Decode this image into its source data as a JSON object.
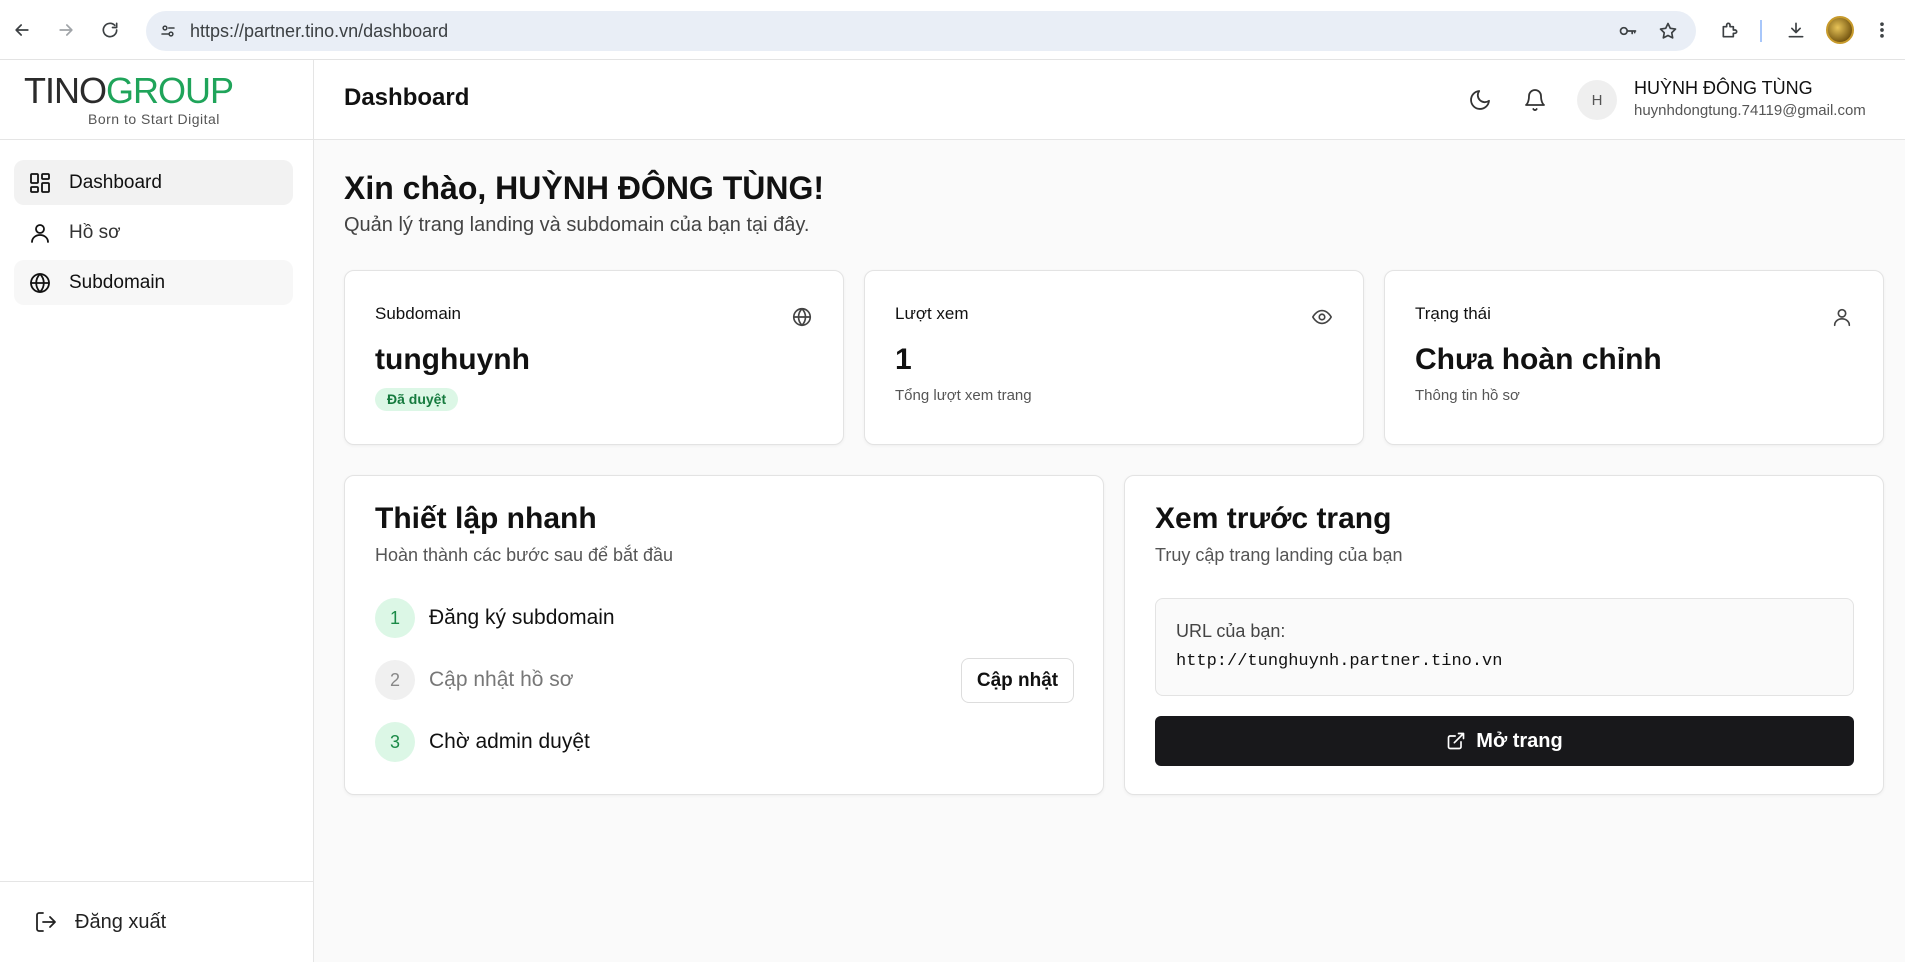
{
  "browser": {
    "url": "https://partner.tino.vn/dashboard",
    "icons": [
      "back-icon",
      "forward-icon",
      "reload-icon",
      "site-info-icon",
      "key-icon",
      "star-icon",
      "extensions-icon",
      "download-icon",
      "menu-icon"
    ]
  },
  "brand": {
    "logo_part1": "TINO",
    "logo_part2": "GROUP",
    "tagline": "Born to Start Digital",
    "colors": {
      "dark": "#2b2b2b",
      "green": "#1fa45a"
    }
  },
  "sidebar": {
    "items": [
      {
        "label": "Dashboard",
        "icon": "dashboard-icon"
      },
      {
        "label": "Hồ sơ",
        "icon": "user-icon"
      },
      {
        "label": "Subdomain",
        "icon": "globe-icon"
      }
    ],
    "logout_label": "Đăng xuất"
  },
  "header": {
    "title": "Dashboard",
    "avatar_initial": "H",
    "user_name": "HUỲNH ĐÔNG TÙNG",
    "user_email": "huynhdongtung.74119@gmail.com"
  },
  "main": {
    "greeting": "Xin chào, HUỲNH ĐÔNG TÙNG!",
    "subtitle": "Quản lý trang landing và subdomain của bạn tại đây.",
    "stats": [
      {
        "label": "Subdomain",
        "value": "tunghuynh",
        "badge": "Đã duyệt",
        "icon": "globe-icon"
      },
      {
        "label": "Lượt xem",
        "value": "1",
        "note": "Tổng lượt xem trang",
        "icon": "eye-icon"
      },
      {
        "label": "Trạng thái",
        "value": "Chưa hoàn chỉnh",
        "note": "Thông tin hồ sơ",
        "icon": "user-icon"
      }
    ],
    "quick_setup": {
      "title": "Thiết lập nhanh",
      "desc": "Hoàn thành các bước sau để bắt đầu",
      "steps": [
        {
          "num": "1",
          "label": "Đăng ký subdomain",
          "done": true
        },
        {
          "num": "2",
          "label": "Cập nhật hồ sơ",
          "done": false
        },
        {
          "num": "3",
          "label": "Chờ admin duyệt",
          "done": true
        }
      ],
      "update_button": "Cập nhật"
    },
    "preview": {
      "title": "Xem trước trang",
      "desc": "Truy cập trang landing của bạn",
      "url_label": "URL của bạn:",
      "url_value": "http://tunghuynh.partner.tino.vn",
      "open_button": "Mở trang"
    }
  },
  "colors": {
    "accent_dark": "#18181b",
    "success_bg": "#dcf7e6",
    "success_text": "#157a3e"
  }
}
